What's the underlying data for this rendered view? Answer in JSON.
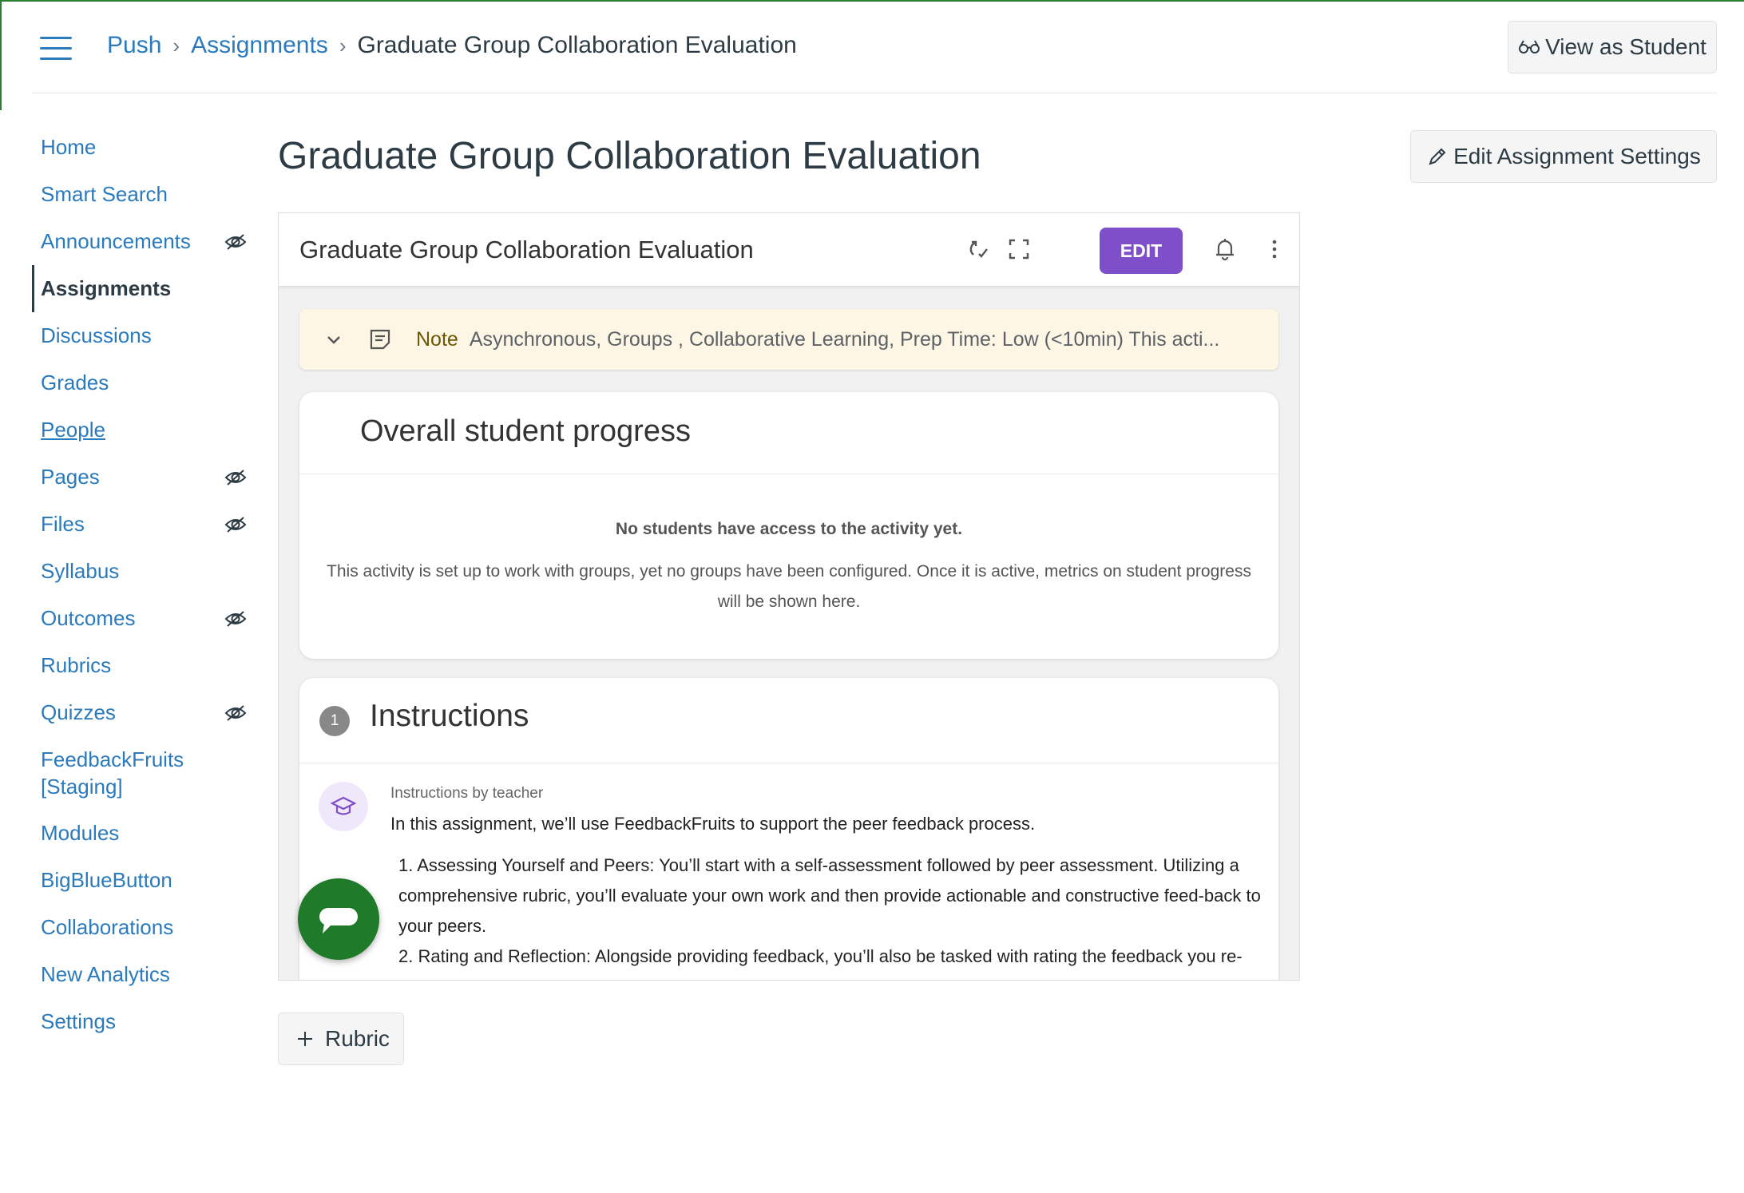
{
  "breadcrumb": {
    "course": "Push",
    "section": "Assignments",
    "current": "Graduate Group Collaboration Evaluation"
  },
  "header": {
    "view_as_student": "View as Student"
  },
  "sidebar": {
    "items": [
      {
        "label": "Home",
        "hidden": false
      },
      {
        "label": "Smart Search",
        "hidden": false
      },
      {
        "label": "Announcements",
        "hidden": true
      },
      {
        "label": "Assignments",
        "hidden": false,
        "active": true
      },
      {
        "label": "Discussions",
        "hidden": false
      },
      {
        "label": "Grades",
        "hidden": false
      },
      {
        "label": "People",
        "hidden": false
      },
      {
        "label": "Pages",
        "hidden": true
      },
      {
        "label": "Files",
        "hidden": true
      },
      {
        "label": "Syllabus",
        "hidden": false
      },
      {
        "label": "Outcomes",
        "hidden": true
      },
      {
        "label": "Rubrics",
        "hidden": false
      },
      {
        "label": "Quizzes",
        "hidden": true
      },
      {
        "label": "FeedbackFruits [Staging]",
        "hidden": false
      },
      {
        "label": "Modules",
        "hidden": false
      },
      {
        "label": "BigBlueButton",
        "hidden": false
      },
      {
        "label": "Collaborations",
        "hidden": false
      },
      {
        "label": "New Analytics",
        "hidden": false
      },
      {
        "label": "Settings",
        "hidden": false
      }
    ]
  },
  "main": {
    "title": "Graduate Group Collaboration Evaluation",
    "edit_settings": "Edit Assignment Settings",
    "rubric_button": "Rubric"
  },
  "activity": {
    "title": "Graduate Group Collaboration Evaluation",
    "edit_label": "EDIT",
    "note": {
      "label": "Note",
      "text": "Asynchronous, Groups , Collaborative Learning, Prep Time: Low (<10min) This acti..."
    },
    "progress": {
      "heading": "Overall student progress",
      "empty_title": "No students have access to the activity yet.",
      "empty_body": "This activity is set up to work with groups, yet no groups have been configured. Once it is active, metrics on student progress will be shown here."
    },
    "instructions": {
      "step": "1",
      "heading": "Instructions",
      "by": "Instructions by teacher",
      "intro": "In this assignment, we’ll use FeedbackFruits to support the peer feedback process.",
      "steps": [
        "1.  Assessing Yourself and Peers: You’ll start with a self-assessment followed by peer assessment. Utilizing a comprehensive rubric, you’ll evaluate your own work and then provide actionable and constructive feed-back to your peers.",
        "2.  Rating and Reflection: Alongside providing feedback, you’ll also be tasked with rating the feedback you re-"
      ]
    }
  },
  "colors": {
    "link": "#2b7abc",
    "accent_green": "#2e7d32",
    "edit_purple": "#7f4fc9",
    "note_bg": "#fdf6e4",
    "chat_green": "#1f7a2a"
  }
}
